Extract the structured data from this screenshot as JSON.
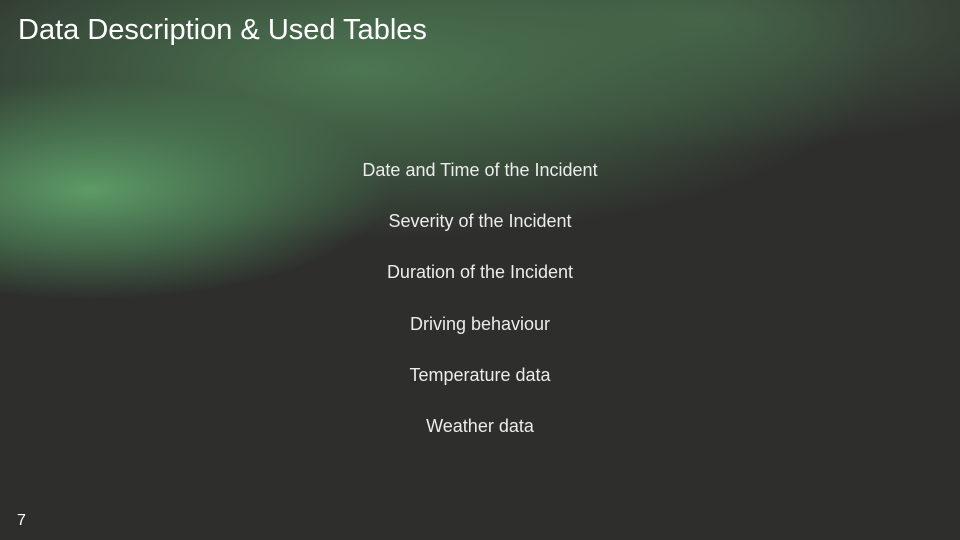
{
  "slide": {
    "title": "Data Description & Used Tables",
    "items": [
      "Date and Time of the Incident",
      "Severity of the Incident",
      "Duration of the Incident",
      "Driving behaviour",
      "Temperature data",
      "Weather data"
    ],
    "page_number": "7"
  }
}
